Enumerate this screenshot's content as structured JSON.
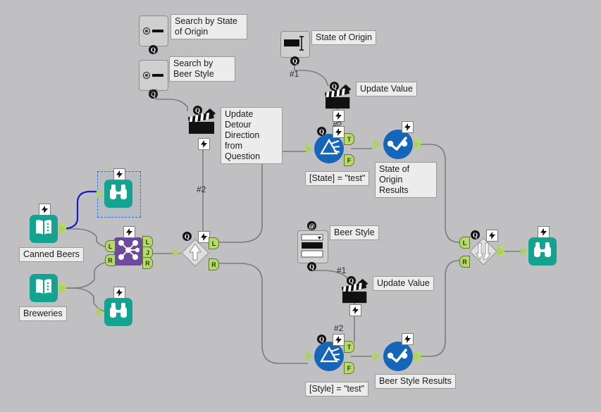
{
  "canvas": {
    "background": "#c0c0c2",
    "app": "workflow-canvas"
  },
  "colors": {
    "teal": "#14a391",
    "purple": "#6e4a9e",
    "blue": "#1565b8",
    "port_green": "#b5d96b",
    "wire": "#7c7c7c",
    "selected_wire": "#1a1ad0",
    "selection": "#2f6fd0"
  },
  "nodes": [
    {
      "id": "radio-state",
      "name": "radio-button-tool-state",
      "label": "",
      "icon": "radio-button-icon"
    },
    {
      "id": "radio-style",
      "name": "radio-button-tool-style",
      "label": "",
      "icon": "radio-button-icon"
    },
    {
      "id": "text-state",
      "name": "text-input-tool-state",
      "label": "",
      "icon": "text-box-icon"
    },
    {
      "id": "dropdown-style",
      "name": "dropdown-tool-style",
      "label": "",
      "icon": "listbox-icon"
    },
    {
      "id": "action-detour",
      "name": "action-tool-detour",
      "label": "",
      "icon": "clapperboard-icon"
    },
    {
      "id": "action-update-top",
      "name": "action-tool-update-state",
      "label": "",
      "icon": "clapperboard-icon"
    },
    {
      "id": "action-update-bot",
      "name": "action-tool-update-style",
      "label": "",
      "icon": "clapperboard-icon"
    },
    {
      "id": "input-canned",
      "name": "input-data-canned-beers",
      "label": "",
      "icon": "book-icon"
    },
    {
      "id": "input-breweries",
      "name": "input-data-breweries",
      "label": "",
      "icon": "book-icon"
    },
    {
      "id": "browse-canned",
      "name": "browse-tool-canned",
      "label": "",
      "icon": "binoculars-icon"
    },
    {
      "id": "browse-breweries",
      "name": "browse-tool-breweries",
      "label": "",
      "icon": "binoculars-icon"
    },
    {
      "id": "browse-final",
      "name": "browse-tool-final",
      "label": "",
      "icon": "binoculars-icon"
    },
    {
      "id": "join",
      "name": "join-tool",
      "label": "",
      "icon": "join-icon"
    },
    {
      "id": "detour-start",
      "name": "detour-start-tool",
      "label": "",
      "icon": "detour-icon"
    },
    {
      "id": "detour-end",
      "name": "detour-end-tool",
      "label": "",
      "icon": "detour-end-icon"
    },
    {
      "id": "filter-state",
      "name": "filter-tool-state",
      "label": "",
      "icon": "filter-icon"
    },
    {
      "id": "filter-style",
      "name": "filter-tool-style",
      "label": "",
      "icon": "filter-icon"
    },
    {
      "id": "browse-state-res",
      "name": "browse-tool-state-results",
      "label": "",
      "icon": "check-browse-icon"
    },
    {
      "id": "browse-style-res",
      "name": "browse-tool-style-results",
      "label": "",
      "icon": "check-browse-icon"
    }
  ],
  "labels": {
    "search_by_state": "Search by State of Origin",
    "search_by_beer_style": "Search by Beer Style",
    "state_of_origin": "State of Origin",
    "beer_style": "Beer Style",
    "update_value_top": "Update Value",
    "update_value_bottom": "Update Value",
    "update_detour": "Update Detour Direction from Question",
    "canned_beers": "Canned Beers",
    "breweries": "Breweries",
    "filter_state_expr": "[State] = \"test\"",
    "filter_style_expr": "[Style] = \"test\"",
    "state_results": "State of Origin Results",
    "beer_style_results": "Beer Style Results"
  },
  "connection_labels": {
    "radio_style_out": "#1",
    "detour_action_out": "#2",
    "text_state_out": "#1",
    "action_update_top_out": "#2",
    "dropdown_style_out": "#1",
    "action_update_bot_out": "#2"
  },
  "ports": {
    "left": "L",
    "right": "R",
    "join": "J",
    "true": "T",
    "false": "F"
  },
  "badges": {
    "question": "Q",
    "at": "@"
  }
}
